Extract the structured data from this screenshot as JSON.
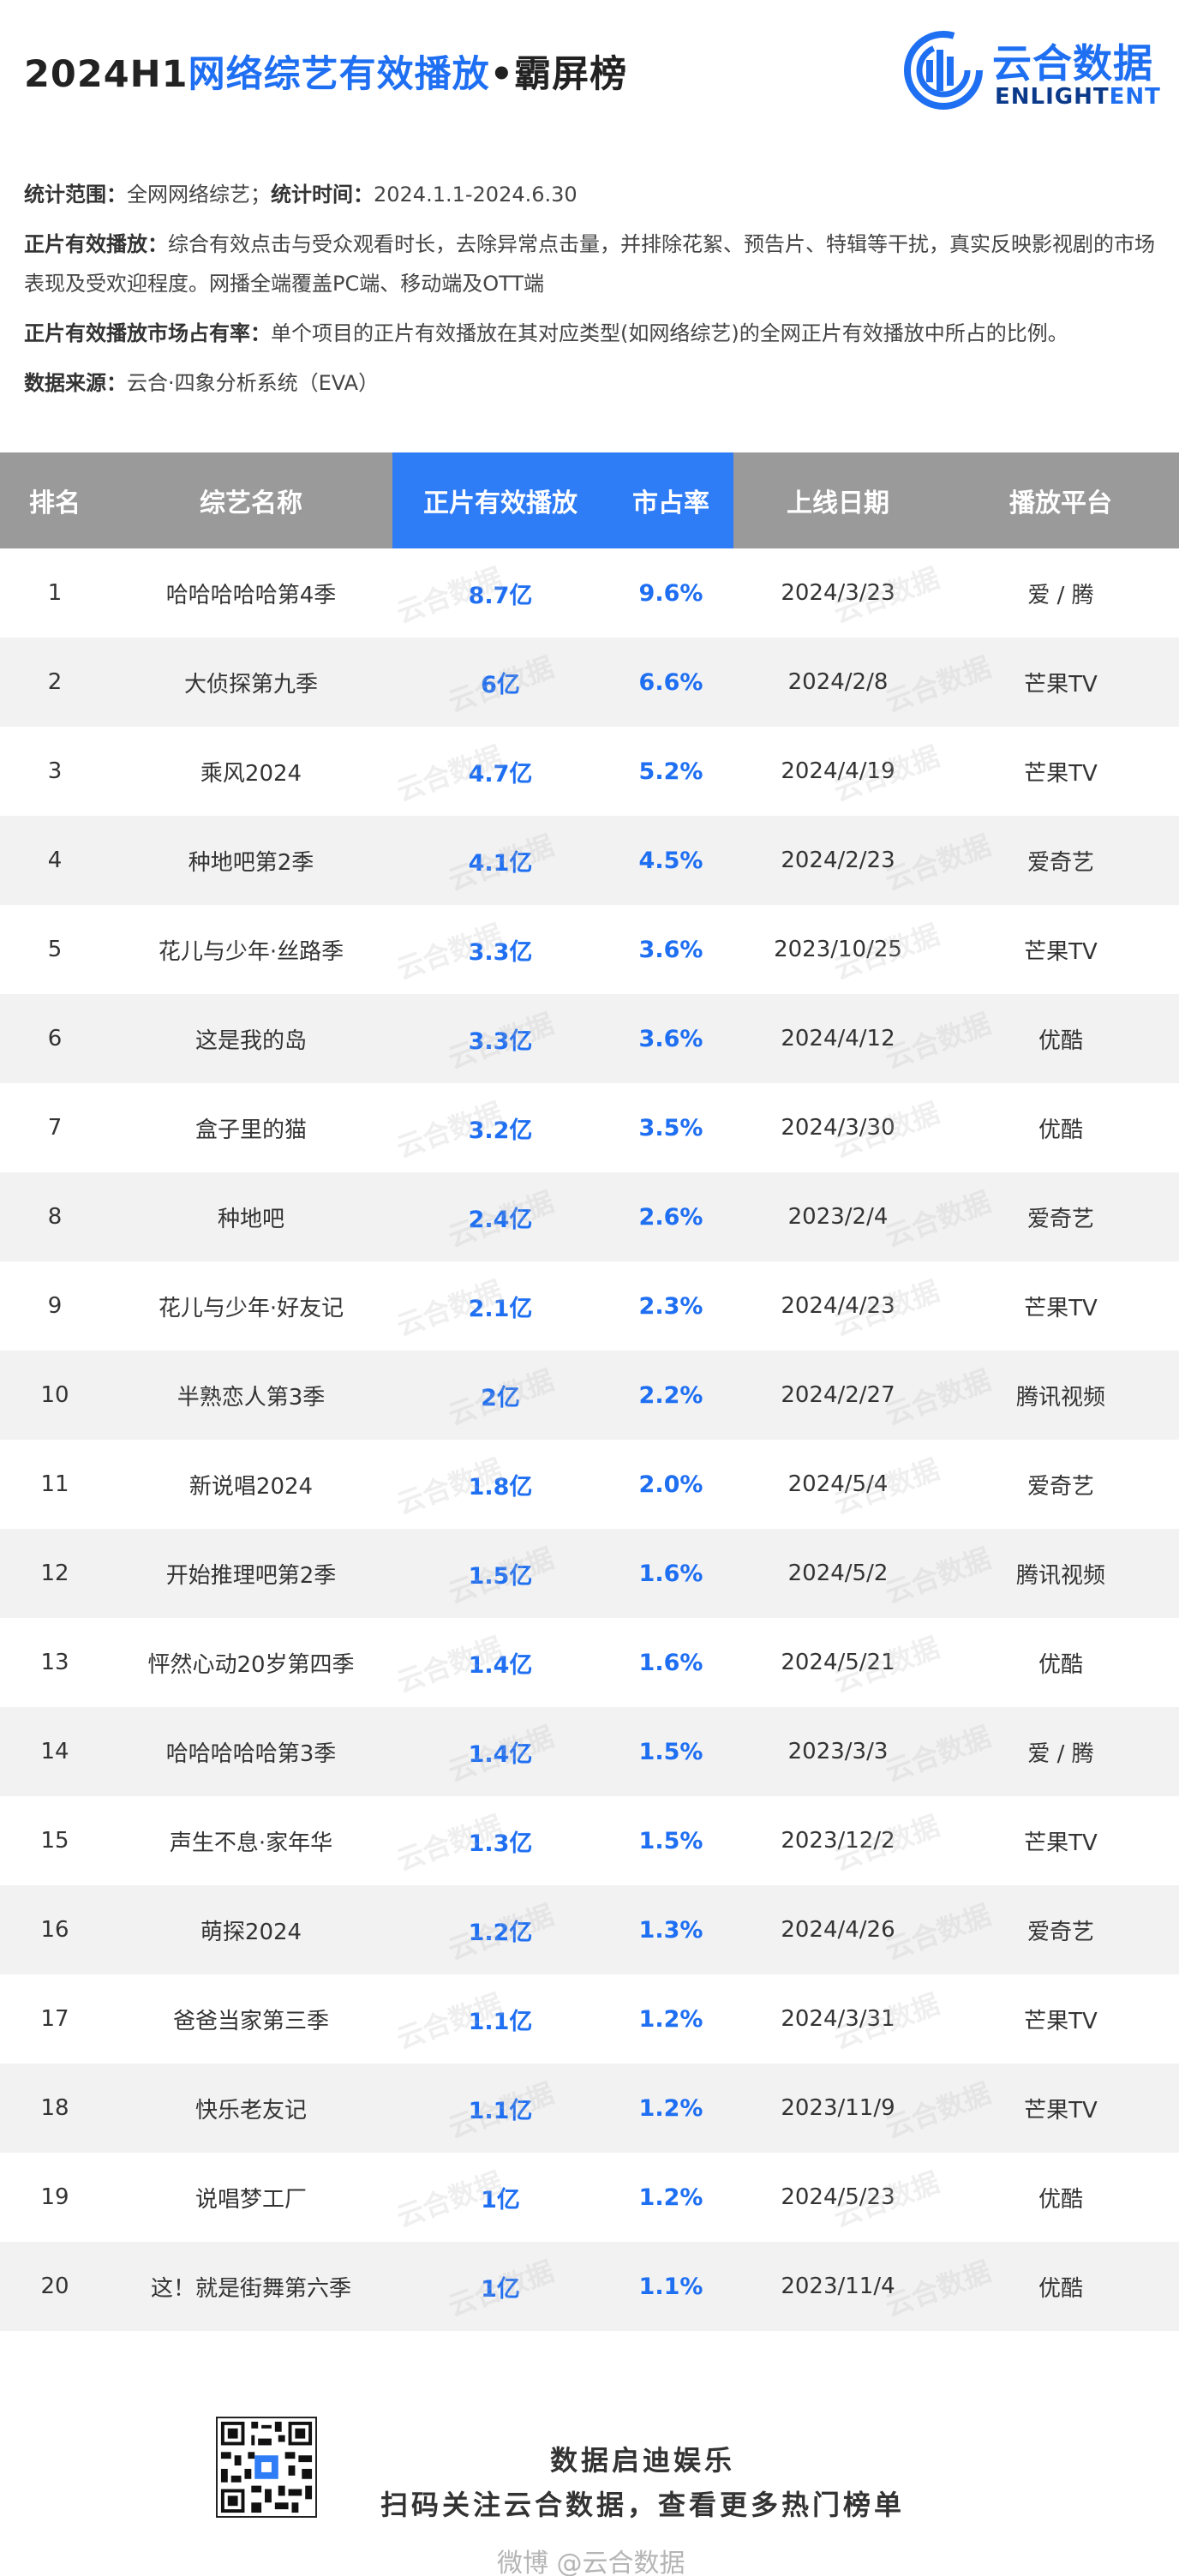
{
  "header": {
    "title_part1": "2024H1",
    "title_part2": "网络综艺有效播放",
    "title_part3": "•霸屏榜",
    "logo_cn": "云合数据",
    "logo_en_part1": "ENLIGHT",
    "logo_en_part2": "ENT",
    "brand_color": "#1f6ff2"
  },
  "description": {
    "scope_key": "统计范围：",
    "scope_val": "全网网络综艺；",
    "time_key": "统计时间：",
    "time_val": "2024.1.1-2024.6.30",
    "play_key": "正片有效播放：",
    "play_val": "综合有效点击与受众观看时长，去除异常点击量，并排除花絮、预告片、特辑等干扰，真实反映影视剧的市场表现及受欢迎程度。网播全端覆盖PC端、移动端及OTT端",
    "share_key": "正片有效播放市场占有率：",
    "share_val": "单个项目的正片有效播放在其对应类型(如网络综艺)的全网正片有效播放中所占的比例。",
    "source_key": "数据来源：",
    "source_val": "云合·四象分析系统（EVA）"
  },
  "table": {
    "headers": [
      "排名",
      "综艺名称",
      "正片有效播放",
      "市占率",
      "上线日期",
      "播放平台"
    ],
    "header_bg": "#9a9a9a",
    "highlight_bg": "#2e7cf6",
    "rows": [
      {
        "rank": "1",
        "name": "哈哈哈哈哈第4季",
        "plays": "8.7亿",
        "share": "9.6%",
        "date": "2024/3/23",
        "platform": "爱 / 腾"
      },
      {
        "rank": "2",
        "name": "大侦探第九季",
        "plays": "6亿",
        "share": "6.6%",
        "date": "2024/2/8",
        "platform": "芒果TV"
      },
      {
        "rank": "3",
        "name": "乘风2024",
        "plays": "4.7亿",
        "share": "5.2%",
        "date": "2024/4/19",
        "platform": "芒果TV"
      },
      {
        "rank": "4",
        "name": "种地吧第2季",
        "plays": "4.1亿",
        "share": "4.5%",
        "date": "2024/2/23",
        "platform": "爱奇艺"
      },
      {
        "rank": "5",
        "name": "花儿与少年·丝路季",
        "plays": "3.3亿",
        "share": "3.6%",
        "date": "2023/10/25",
        "platform": "芒果TV"
      },
      {
        "rank": "6",
        "name": "这是我的岛",
        "plays": "3.3亿",
        "share": "3.6%",
        "date": "2024/4/12",
        "platform": "优酷"
      },
      {
        "rank": "7",
        "name": "盒子里的猫",
        "plays": "3.2亿",
        "share": "3.5%",
        "date": "2024/3/30",
        "platform": "优酷"
      },
      {
        "rank": "8",
        "name": "种地吧",
        "plays": "2.4亿",
        "share": "2.6%",
        "date": "2023/2/4",
        "platform": "爱奇艺"
      },
      {
        "rank": "9",
        "name": "花儿与少年·好友记",
        "plays": "2.1亿",
        "share": "2.3%",
        "date": "2024/4/23",
        "platform": "芒果TV"
      },
      {
        "rank": "10",
        "name": "半熟恋人第3季",
        "plays": "2亿",
        "share": "2.2%",
        "date": "2024/2/27",
        "platform": "腾讯视频"
      },
      {
        "rank": "11",
        "name": "新说唱2024",
        "plays": "1.8亿",
        "share": "2.0%",
        "date": "2024/5/4",
        "platform": "爱奇艺"
      },
      {
        "rank": "12",
        "name": "开始推理吧第2季",
        "plays": "1.5亿",
        "share": "1.6%",
        "date": "2024/5/2",
        "platform": "腾讯视频"
      },
      {
        "rank": "13",
        "name": "怦然心动20岁第四季",
        "plays": "1.4亿",
        "share": "1.6%",
        "date": "2024/5/21",
        "platform": "优酷"
      },
      {
        "rank": "14",
        "name": "哈哈哈哈哈第3季",
        "plays": "1.4亿",
        "share": "1.5%",
        "date": "2023/3/3",
        "platform": "爱 / 腾"
      },
      {
        "rank": "15",
        "name": "声生不息·家年华",
        "plays": "1.3亿",
        "share": "1.5%",
        "date": "2023/12/2",
        "platform": "芒果TV"
      },
      {
        "rank": "16",
        "name": "萌探2024",
        "plays": "1.2亿",
        "share": "1.3%",
        "date": "2024/4/26",
        "platform": "爱奇艺"
      },
      {
        "rank": "17",
        "name": "爸爸当家第三季",
        "plays": "1.1亿",
        "share": "1.2%",
        "date": "2024/3/31",
        "platform": "芒果TV"
      },
      {
        "rank": "18",
        "name": "快乐老友记",
        "plays": "1.1亿",
        "share": "1.2%",
        "date": "2023/11/9",
        "platform": "芒果TV"
      },
      {
        "rank": "19",
        "name": "说唱梦工厂",
        "plays": "1亿",
        "share": "1.2%",
        "date": "2024/5/23",
        "platform": "优酷"
      },
      {
        "rank": "20",
        "name": "这！就是街舞第六季",
        "plays": "1亿",
        "share": "1.1%",
        "date": "2023/11/4",
        "platform": "优酷"
      }
    ],
    "watermark": "云合数据"
  },
  "footer": {
    "line1": "数据启迪娱乐",
    "line2": "扫码关注云合数据，查看更多热门榜单",
    "weibo": "微博 @云合数据"
  }
}
